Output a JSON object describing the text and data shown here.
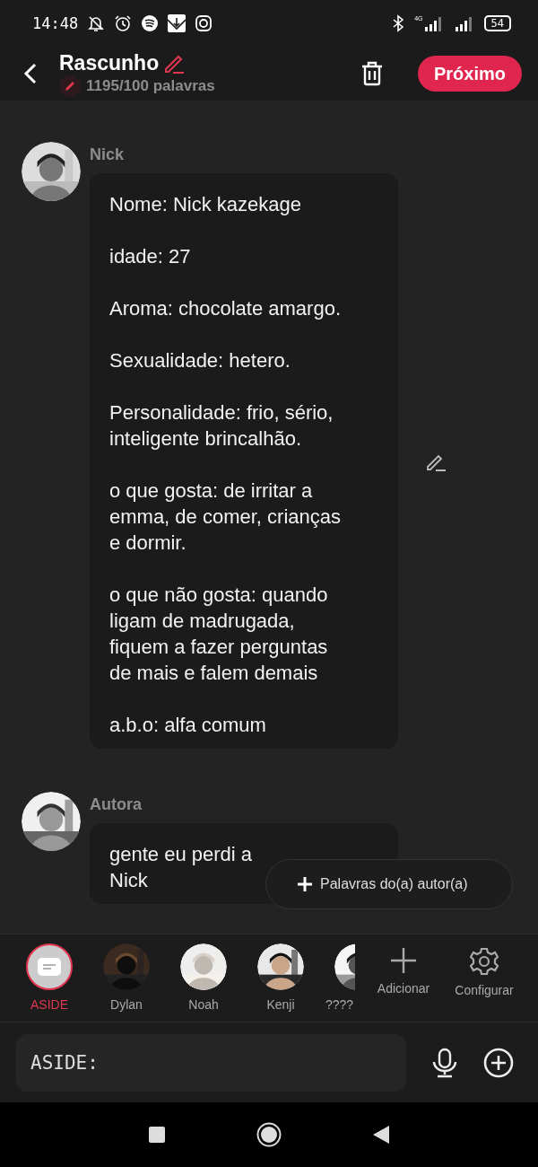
{
  "status_bar": {
    "time": "14:48",
    "network_type": "4G",
    "battery": "54"
  },
  "header": {
    "title": "Rascunho",
    "word_count": "1195/100 palavras",
    "next_button": "Próximo"
  },
  "messages": [
    {
      "author": "Nick",
      "editable": true,
      "paragraphs": [
        [
          "Nome: Nick kazekage"
        ],
        [
          "idade: 27"
        ],
        [
          "Aroma: chocolate amargo."
        ],
        [
          "Sexualidade: hetero."
        ],
        [
          "Personalidade: frio, sério,",
          "inteligente brincalhão."
        ],
        [
          "o que gosta: de irritar a",
          "emma, de comer, crianças",
          "e dormir."
        ],
        [
          "o que não gosta: quando",
          "ligam de madrugada,",
          "fiquem a fazer perguntas",
          "de mais e falem demais"
        ],
        [
          "a.b.o: alfa comum"
        ]
      ]
    },
    {
      "author": "Autora",
      "editable": false,
      "paragraphs": [
        [
          "gente eu perdi a",
          "Nick"
        ]
      ]
    }
  ],
  "author_words_button": "Palavras do(a) autor(a)",
  "characters": [
    {
      "name": "ASIDE",
      "kind": "aside",
      "selected": true
    },
    {
      "name": "Dylan",
      "kind": "avatar",
      "selected": false
    },
    {
      "name": "Noah",
      "kind": "avatar",
      "selected": false
    },
    {
      "name": "Kenji",
      "kind": "avatar",
      "selected": false
    },
    {
      "name": "????",
      "kind": "avatar",
      "selected": false
    }
  ],
  "actions": [
    {
      "label": "Adicionar",
      "kind": "add"
    },
    {
      "label": "Configurar",
      "kind": "settings"
    }
  ],
  "input": {
    "placeholder": "ASIDE:"
  }
}
